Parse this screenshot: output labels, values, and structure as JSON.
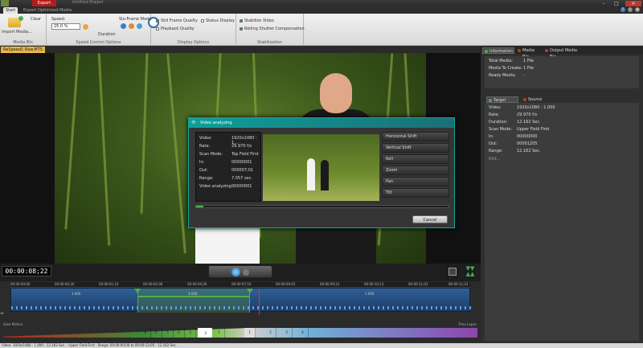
{
  "window": {
    "export_tab": "Export",
    "title": "Untitled Project"
  },
  "ribbon_tabs": {
    "start": "Start",
    "export_opt": "Export Optimized Media"
  },
  "ribbon": {
    "media_bin": {
      "import": "Import Media...",
      "clear": "Clear",
      "label": "Media Bin"
    },
    "speed": {
      "speed_label": "Speed:",
      "speed_value": "25.0 %",
      "duration": "Duration",
      "slow_frame": "Slo-Frame Mode",
      "label": "Speed Control Options"
    },
    "display": {
      "still_frame": "Still Frame Quality",
      "status": "Status Display",
      "playback": "Playback Quality",
      "label": "Display Options"
    },
    "stabilization": {
      "stabilize": "Stabilize Video",
      "rolling": "Rolling Shutter Compensation",
      "label": "Stabilization"
    }
  },
  "file_tab": "ReSpeed1 Raw.MTS",
  "dialog": {
    "title": "Video analyzing",
    "info": [
      {
        "k": "Video:",
        "v": "1920x1080 : 1..."
      },
      {
        "k": "Rate:",
        "v": "29.970 f/s"
      },
      {
        "k": "Scan Mode:",
        "v": "Top Field First"
      },
      {
        "k": "In:",
        "v": "00000001"
      },
      {
        "k": "Out:",
        "v": "000007;01"
      },
      {
        "k": "Range:",
        "v": "7.057 sec."
      },
      {
        "k": "Video analyzing:",
        "v": "00000001"
      }
    ],
    "motion": [
      "Horizontal Shift",
      "Vertical Shift",
      "Roll",
      "Zoom",
      "Pan",
      "Tilt"
    ],
    "progress": 0.03,
    "cancel": "Cancel"
  },
  "right_panel": {
    "tabs": {
      "info": "Information",
      "media_bin": "Media Bin",
      "output": "Output Media Bin"
    },
    "summary": [
      {
        "k": "Total Media:",
        "v": "1 File"
      },
      {
        "k": "Media To Create:",
        "v": "1 File"
      },
      {
        "k": "Ready Media:",
        "v": "-"
      }
    ],
    "sub_tabs": {
      "target": "Target Media",
      "source": "Source Media"
    },
    "target": [
      {
        "k": "Video:",
        "v": "1920x1080 : 1.000"
      },
      {
        "k": "Rate:",
        "v": "29.970 f/s"
      },
      {
        "k": "Duration:",
        "v": "12.162 Sec."
      },
      {
        "k": "Scan Mode:",
        "v": "Upper Field First"
      },
      {
        "k": "In:",
        "v": "00000000"
      },
      {
        "k": "Out:",
        "v": "00001205"
      },
      {
        "k": "Range:",
        "v": "12.162 Sec."
      }
    ],
    "edit": "Edit..."
  },
  "transport": {
    "timecode": "00:00:08;22"
  },
  "timeline": {
    "ticks": [
      "00:00:00;00",
      "00:00:00;20",
      "00:00:01;10",
      "00:00:02;06",
      "00:00:04;26",
      "00:00:07;16",
      "00:00:09;03",
      "00:00:09;23",
      "00:00:10;13",
      "00:00:11;03",
      "00:00:11;23"
    ],
    "seg1": "1.000",
    "seg2": "4.000",
    "seg3": "1.000"
  },
  "speed_strip": {
    "slow": "Slow Motion",
    "fast": "Time Lapse",
    "cells": [
      "8",
      "6",
      "5",
      "4",
      "3",
      "2",
      "1",
      "1",
      "2",
      "3",
      "4"
    ]
  },
  "status": "Video: 1920x1080 : 1.000 : 12.162 Sec. : Upper Field First : Range: 00:00:00;00 to 00:00:12;05 - 12.162 Sec."
}
